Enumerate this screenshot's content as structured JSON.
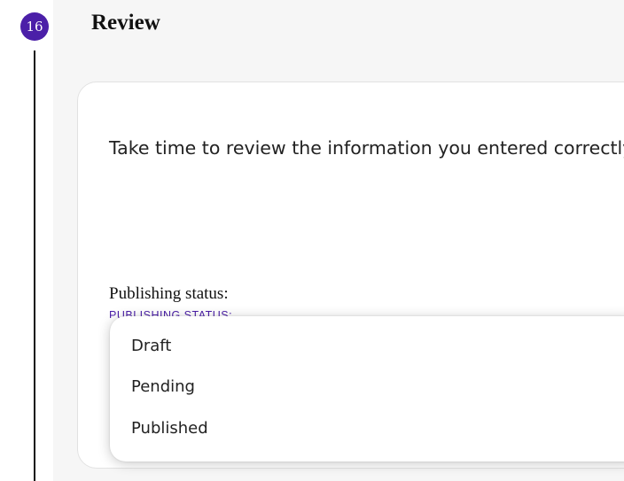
{
  "step": {
    "number": "16",
    "title": "Review"
  },
  "card": {
    "intro": "Take time to review the information you entered correctly.",
    "publishing_status": {
      "label": "Publishing status:",
      "caption": "PUBLISHING STATUS:",
      "options": [
        "Draft",
        "Pending",
        "Published"
      ]
    }
  },
  "colors": {
    "accent": "#4b1fa8",
    "panel_background": "#f6f6f6",
    "card_background": "#ffffff"
  }
}
